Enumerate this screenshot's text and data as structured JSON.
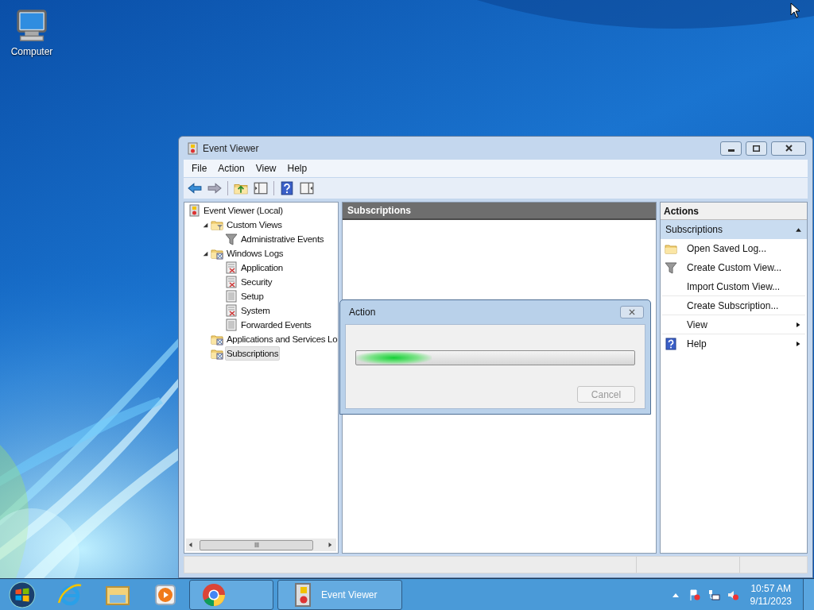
{
  "desktop": {
    "icons": [
      {
        "label": "Computer",
        "kind": "computer"
      }
    ]
  },
  "window": {
    "title": "Event Viewer",
    "menu": [
      "File",
      "Action",
      "View",
      "Help"
    ],
    "tree": [
      {
        "label": "Event Viewer (Local)",
        "kind": "viewer",
        "selected": false,
        "children": [
          {
            "label": "Custom Views",
            "kind": "folder-filter",
            "selected": false,
            "expanded": true,
            "children": [
              {
                "label": "Administrative Events",
                "kind": "filter",
                "selected": false
              }
            ]
          },
          {
            "label": "Windows Logs",
            "kind": "folder-log",
            "selected": false,
            "expanded": true,
            "children": [
              {
                "label": "Application",
                "kind": "log-event",
                "selected": false
              },
              {
                "label": "Security",
                "kind": "log-event",
                "selected": false
              },
              {
                "label": "Setup",
                "kind": "log-plain",
                "selected": false
              },
              {
                "label": "System",
                "kind": "log-event",
                "selected": false
              },
              {
                "label": "Forwarded Events",
                "kind": "log-plain",
                "selected": false
              }
            ]
          },
          {
            "label": "Applications and Services Lo",
            "kind": "folder-log",
            "selected": false
          },
          {
            "label": "Subscriptions",
            "kind": "folder-log",
            "selected": true
          }
        ]
      }
    ],
    "center": {
      "header": "Subscriptions"
    },
    "actions": {
      "header": "Actions",
      "section": {
        "label": "Subscriptions",
        "expanded": true
      },
      "items": [
        {
          "label": "Open Saved Log...",
          "kind": "folder",
          "submenu": false,
          "divider_after": false
        },
        {
          "label": "Create Custom View...",
          "kind": "filter",
          "submenu": false,
          "divider_after": false
        },
        {
          "label": "Import Custom View...",
          "kind": "none",
          "submenu": false,
          "divider_after": true
        },
        {
          "label": "Create Subscription...",
          "kind": "none",
          "submenu": false,
          "divider_after": true
        },
        {
          "label": "View",
          "kind": "none",
          "submenu": true,
          "divider_after": true
        },
        {
          "label": "Help",
          "kind": "help",
          "submenu": true,
          "divider_after": false
        }
      ]
    }
  },
  "dialog": {
    "title": "Action",
    "progress": {
      "level": 0.27
    },
    "buttons": [
      {
        "label": "Cancel",
        "disabled": true
      }
    ]
  },
  "taskbar": {
    "items": [
      {
        "kind": "ie",
        "open": false
      },
      {
        "kind": "explorer",
        "open": false
      },
      {
        "kind": "media",
        "open": false
      },
      {
        "kind": "chrome",
        "open": true
      },
      {
        "kind": "eventviewer",
        "label": "Event Viewer",
        "open": true
      }
    ],
    "tray": {
      "time": "10:57 AM",
      "date": "9/11/2023"
    }
  }
}
